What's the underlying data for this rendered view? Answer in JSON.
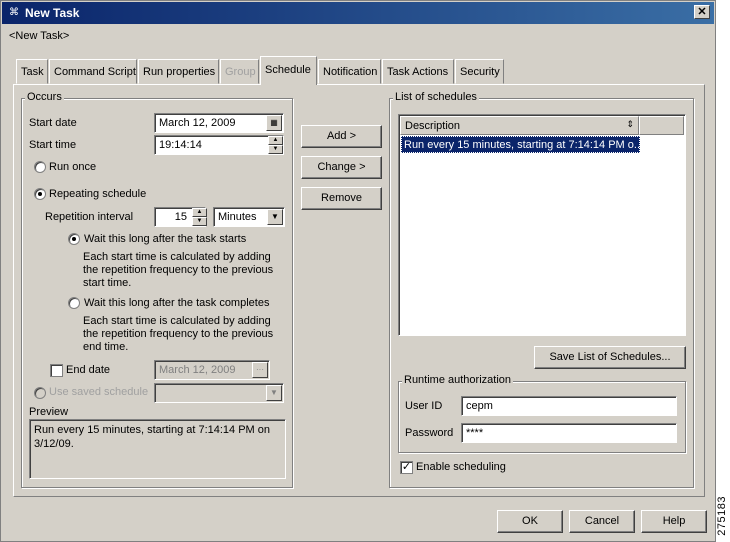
{
  "window": {
    "title": "New Task",
    "subtitle": "<New Task>",
    "close_glyph": "✕"
  },
  "tabs": [
    {
      "label": "Task",
      "state": "normal"
    },
    {
      "label": "Command Script",
      "state": "normal"
    },
    {
      "label": "Run properties",
      "state": "normal"
    },
    {
      "label": "Group",
      "state": "disabled"
    },
    {
      "label": "Schedule",
      "state": "active"
    },
    {
      "label": "Notification",
      "state": "normal"
    },
    {
      "label": "Task Actions",
      "state": "normal"
    },
    {
      "label": "Security",
      "state": "normal"
    }
  ],
  "occurs": {
    "legend": "Occurs",
    "start_date_label": "Start date",
    "start_date_value": "March 12, 2009",
    "start_time_label": "Start time",
    "start_time_value": "19:14:14",
    "run_once_label": "Run once",
    "repeating_label": "Repeating schedule",
    "repetition_interval_label": "Repetition interval",
    "repetition_interval_value": "15",
    "repetition_unit": "Minutes",
    "after_start_label": "Wait this long after the task starts",
    "after_start_desc": "Each start time is calculated by adding the repetition frequency to the previous start time.",
    "after_complete_label": "Wait this long after the task completes",
    "after_complete_desc": "Each start time is calculated by adding the repetition frequency to the previous end time.",
    "end_date_label": "End date",
    "end_date_value": "March 12, 2009",
    "use_saved_label": "Use saved schedule",
    "preview_label": "Preview",
    "preview_text": "Run every 15 minutes, starting at 7:14:14 PM on 3/12/09."
  },
  "buttons": {
    "add": "Add >",
    "change": "Change >",
    "remove": "Remove",
    "save_list": "Save List of Schedules...",
    "ok": "OK",
    "cancel": "Cancel",
    "help": "Help"
  },
  "schedules": {
    "legend": "List of schedules",
    "column_header": "Description",
    "rows": [
      "Run every 15 minutes, starting at 7:14:14 PM o..."
    ]
  },
  "runtime_auth": {
    "legend": "Runtime authorization",
    "user_id_label": "User ID",
    "user_id_value": "cepm",
    "password_label": "Password",
    "password_value": "****"
  },
  "enable_scheduling_label": "Enable scheduling",
  "figure_number": "275183"
}
